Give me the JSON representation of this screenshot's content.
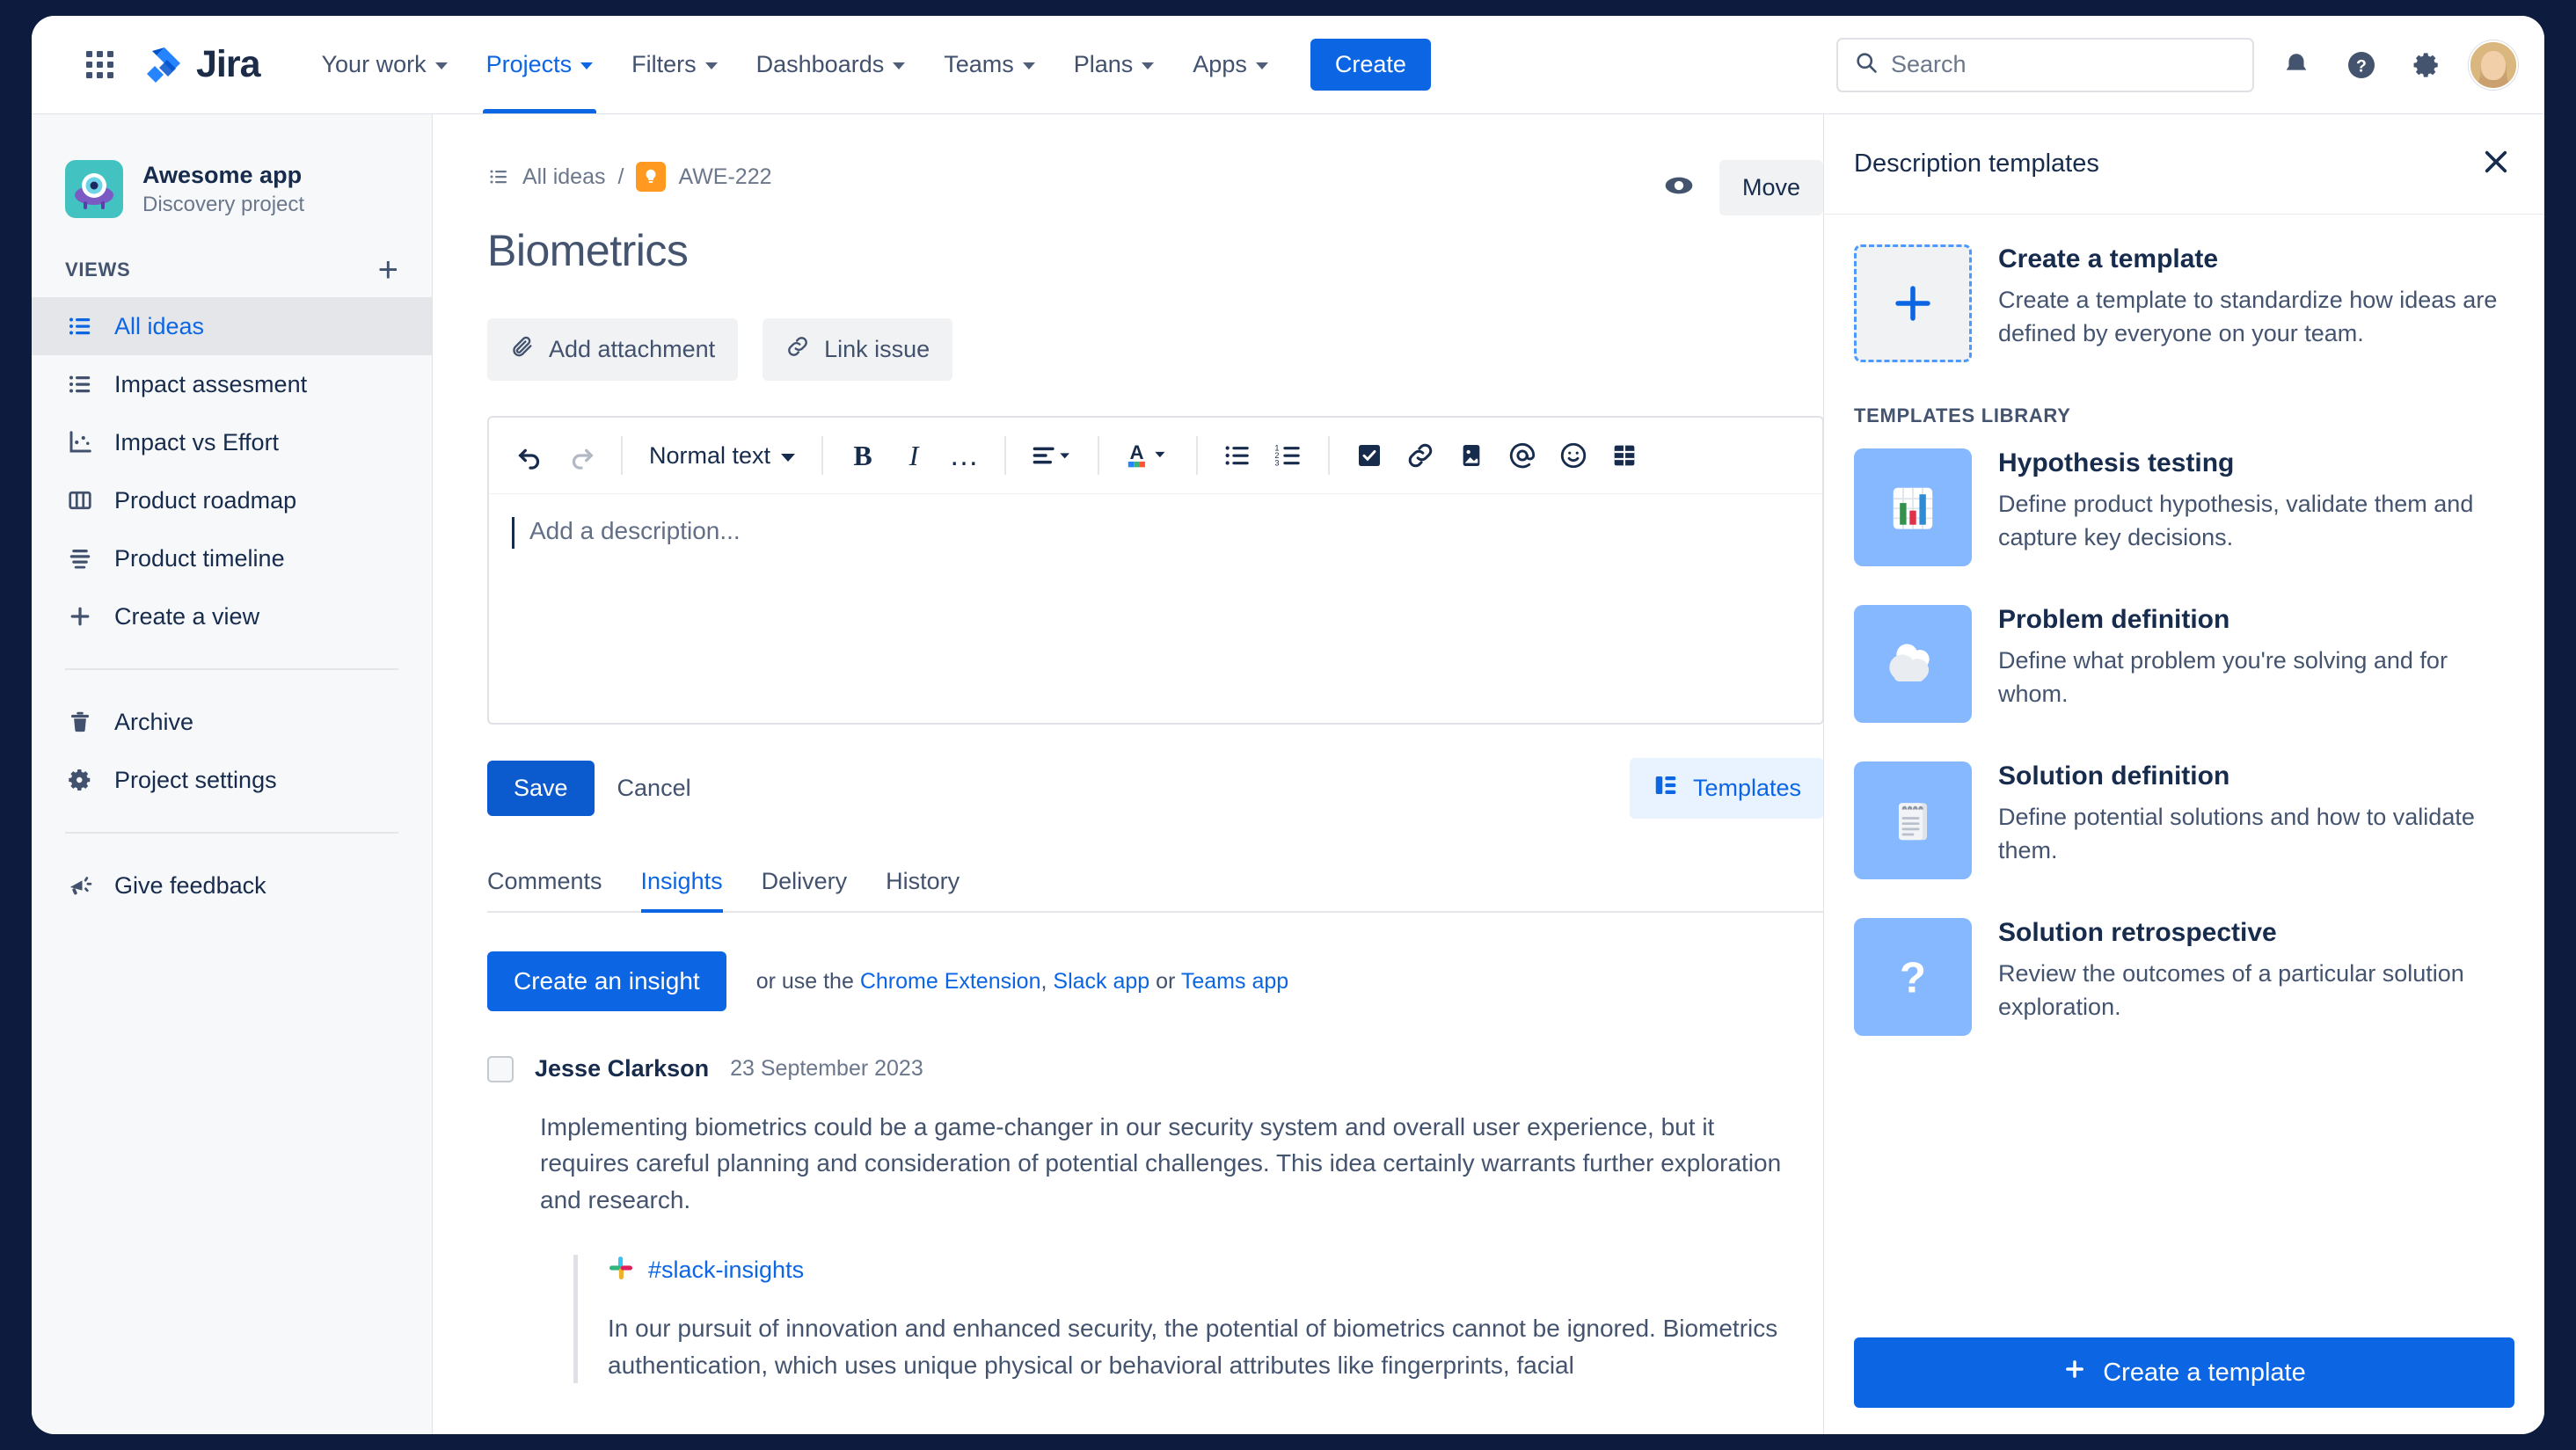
{
  "topnav": {
    "app_switcher": "app-switcher",
    "logo_text": "Jira",
    "items": [
      {
        "label": "Your work",
        "has_chevron": true,
        "active": false
      },
      {
        "label": "Projects",
        "has_chevron": true,
        "active": true
      },
      {
        "label": "Filters",
        "has_chevron": true,
        "active": false
      },
      {
        "label": "Dashboards",
        "has_chevron": true,
        "active": false
      },
      {
        "label": "Teams",
        "has_chevron": true,
        "active": false
      },
      {
        "label": "Plans",
        "has_chevron": true,
        "active": false
      },
      {
        "label": "Apps",
        "has_chevron": true,
        "active": false
      }
    ],
    "create_label": "Create",
    "search_placeholder": "Search",
    "search_value": ""
  },
  "sidebar": {
    "project_name": "Awesome app",
    "project_type": "Discovery project",
    "views_label": "VIEWS",
    "views": [
      {
        "label": "All ideas",
        "icon": "list-icon",
        "selected": true
      },
      {
        "label": "Impact assesment",
        "icon": "list-icon",
        "selected": false
      },
      {
        "label": "Impact vs Effort",
        "icon": "scatter-chart-icon",
        "selected": false
      },
      {
        "label": "Product roadmap",
        "icon": "board-columns-icon",
        "selected": false
      },
      {
        "label": "Product timeline",
        "icon": "timeline-icon",
        "selected": false
      },
      {
        "label": "Create a view",
        "icon": "plus-icon",
        "selected": false
      }
    ],
    "secondary": [
      {
        "label": "Archive",
        "icon": "trash-icon"
      },
      {
        "label": "Project settings",
        "icon": "gear-icon"
      }
    ],
    "feedback": {
      "label": "Give feedback",
      "icon": "megaphone-icon"
    }
  },
  "main": {
    "breadcrumb": {
      "parent": "All ideas",
      "separator": "/",
      "issue_key": "AWE-222"
    },
    "title": "Biometrics",
    "watch_icon": "eye-icon",
    "move_label": "Move",
    "actions": [
      {
        "label": "Add attachment",
        "icon": "paperclip-icon"
      },
      {
        "label": "Link issue",
        "icon": "link-icon"
      }
    ],
    "editor": {
      "undo": "undo-icon",
      "redo": "redo-icon",
      "text_style": "Normal text",
      "bold": "B",
      "italic": "I",
      "more": "…",
      "tools": [
        "align-icon",
        "text-color-icon",
        "bullet-list-icon",
        "numbered-list-icon",
        "task-list-icon",
        "link-icon",
        "image-icon",
        "mention-icon",
        "emoji-icon",
        "table-icon"
      ],
      "placeholder": "Add a description...",
      "value": ""
    },
    "save_label": "Save",
    "cancel_label": "Cancel",
    "templates_label": "Templates",
    "tabs": [
      {
        "label": "Comments",
        "active": false
      },
      {
        "label": "Insights",
        "active": true
      },
      {
        "label": "Delivery",
        "active": false
      },
      {
        "label": "History",
        "active": false
      }
    ],
    "create_insight_label": "Create an insight",
    "or_use_prefix": "or use the ",
    "or_use_links": [
      "Chrome Extension",
      "Slack app",
      "Teams app"
    ],
    "or_use_sep1": ", ",
    "or_use_sep2": " or ",
    "insight": {
      "author": "Jesse Clarkson",
      "date": "23 September 2023",
      "body": "Implementing biometrics could be a game-changer in our security system and overall user experience, but it requires careful planning and consideration of potential challenges. This idea certainly warrants further exploration and research.",
      "quote_source": "#slack-insights",
      "quote_icon": "slack-icon",
      "quote_text": "In our pursuit of innovation and enhanced security, the potential of biometrics cannot be ignored. Biometrics authentication, which uses unique physical or behavioral attributes like fingerprints, facial"
    }
  },
  "right_panel": {
    "title": "Description templates",
    "close_icon": "close-icon",
    "create": {
      "name": "Create a template",
      "desc": "Create a template to standardize how ideas are defined by everyone on your team."
    },
    "library_label": "TEMPLATES LIBRARY",
    "templates": [
      {
        "name": "Hypothesis testing",
        "desc": "Define product hypothesis, validate them and capture key decisions.",
        "icon": "bar-chart-icon"
      },
      {
        "name": "Problem definition",
        "desc": "Define what problem you're solving and for whom.",
        "icon": "cloud-icon"
      },
      {
        "name": "Solution definition",
        "desc": "Define potential solutions and how to validate them.",
        "icon": "notepad-icon"
      },
      {
        "name": "Solution retrospective",
        "desc": "Review the outcomes of a particular solution exploration.",
        "icon": "question-mark-icon"
      }
    ],
    "footer_button": "Create a template"
  },
  "colors": {
    "brand_blue": "#0c66e4",
    "nav_text": "#42526e",
    "heading": "#172b4d",
    "idea_orange": "#ff991f",
    "template_icon_bg": "#85b8ff",
    "project_icon_bg": "#42c2c0"
  }
}
